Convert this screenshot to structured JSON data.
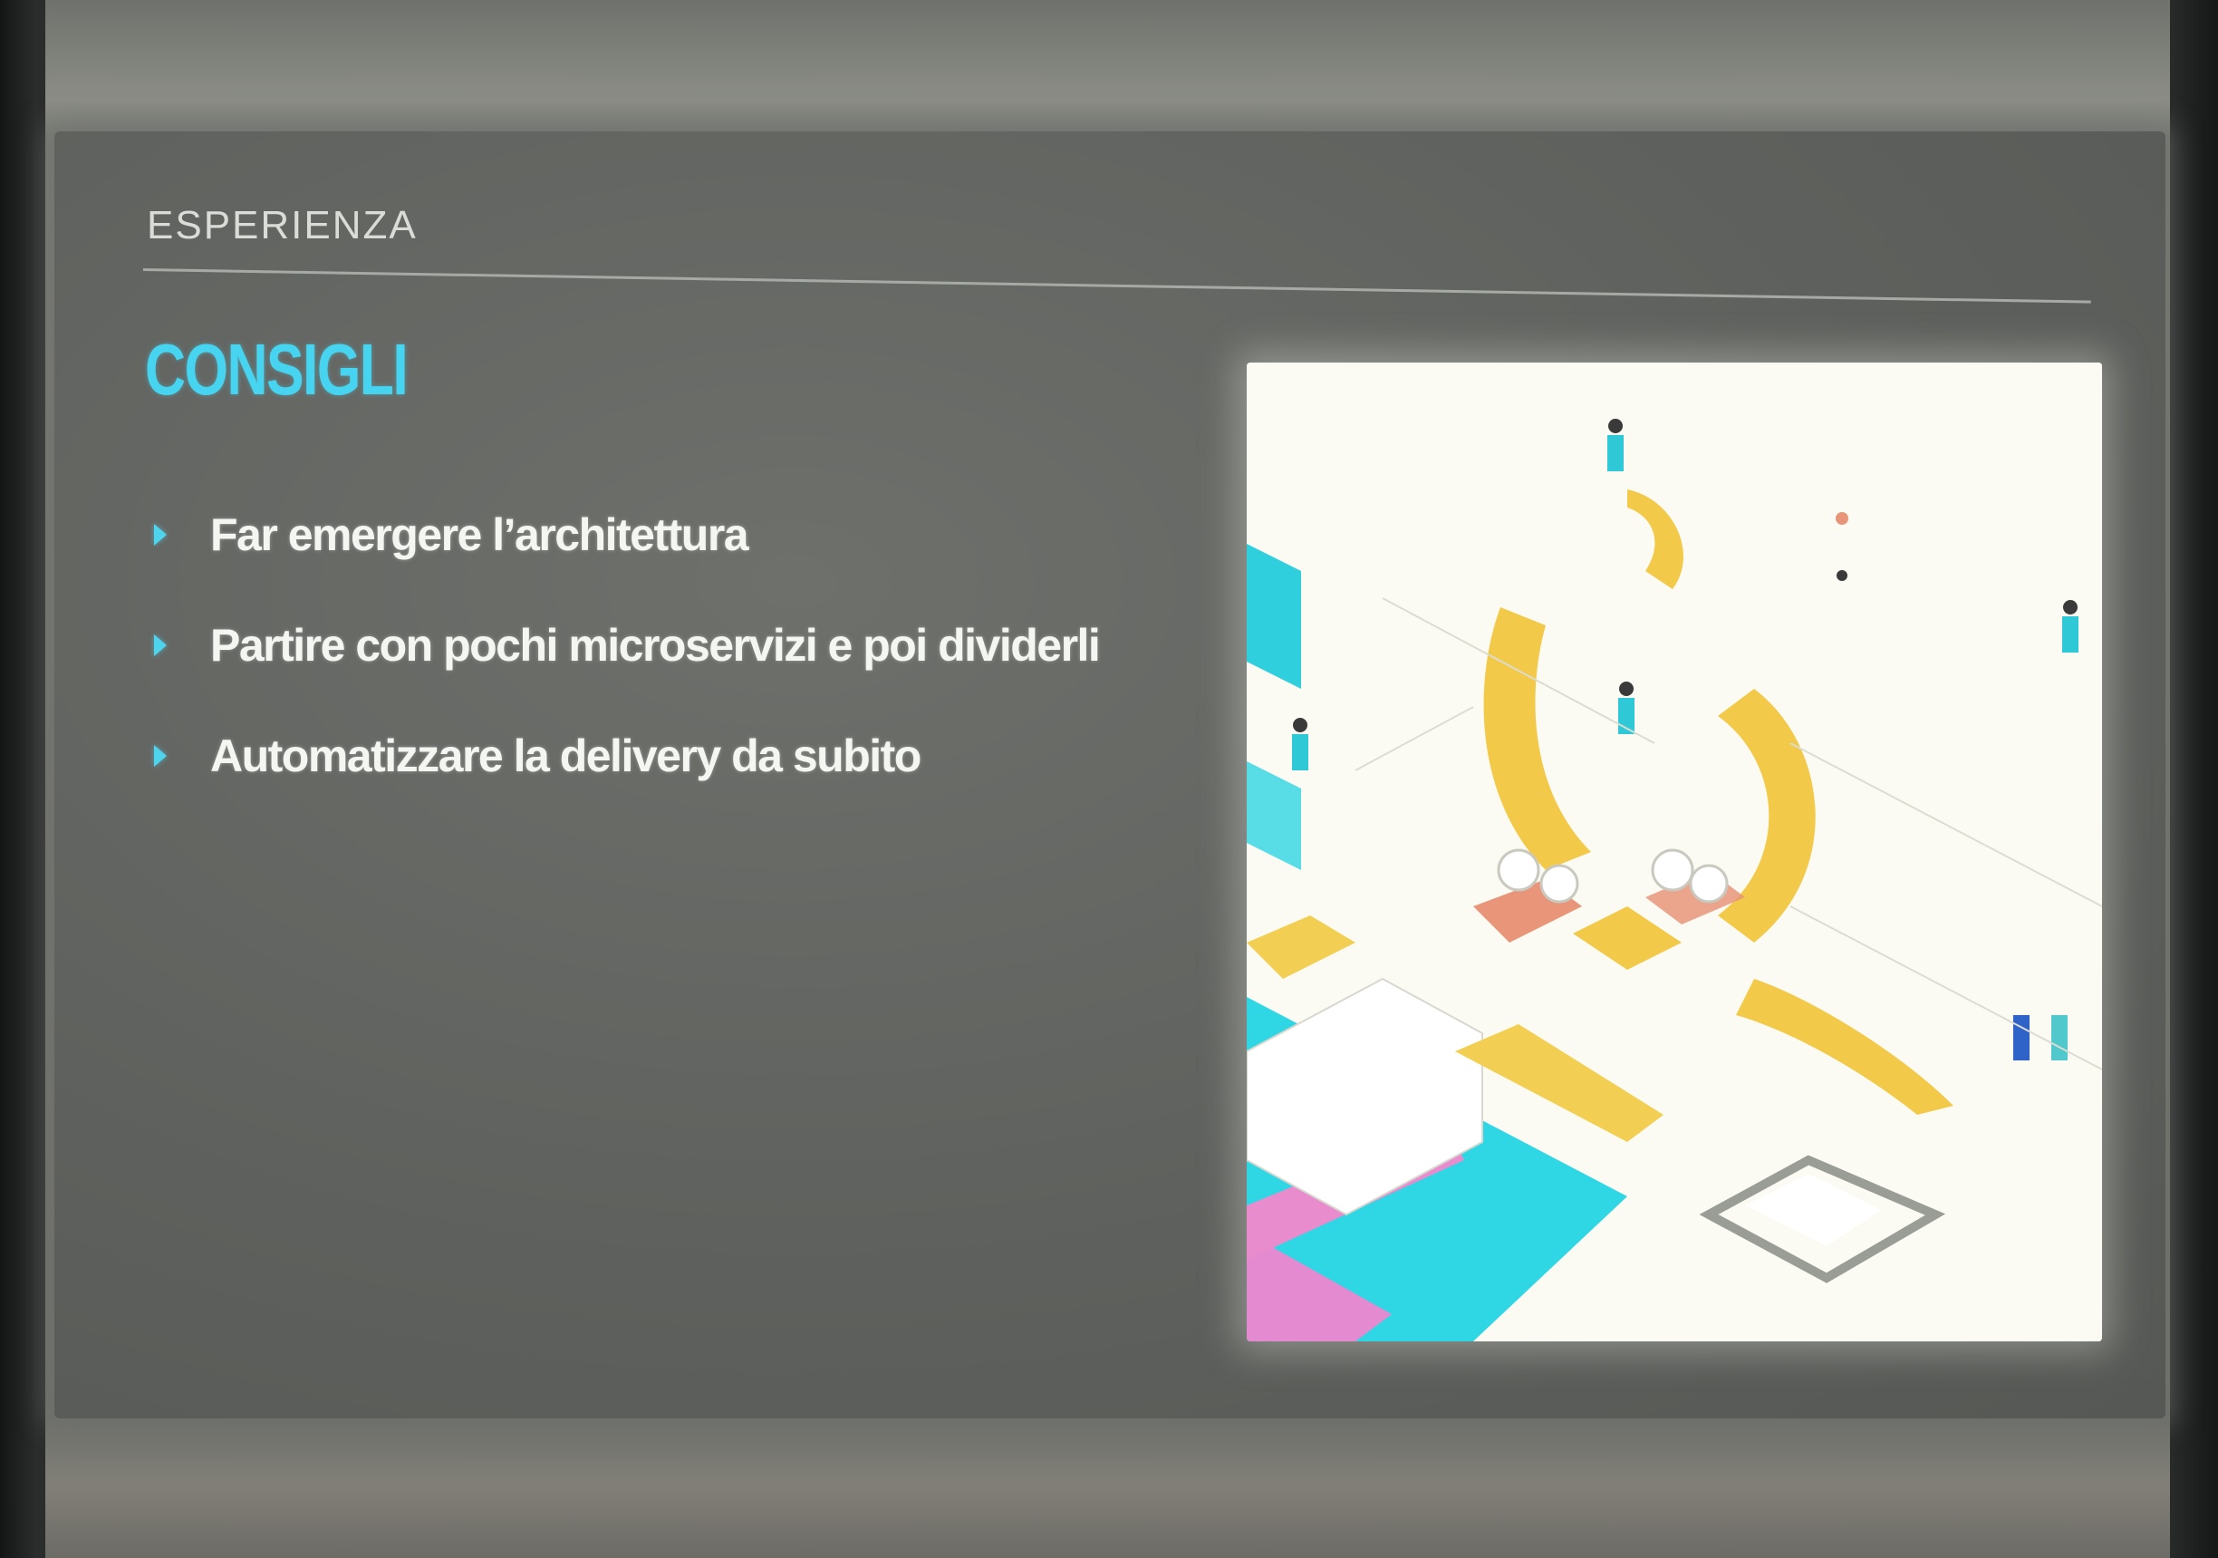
{
  "slide": {
    "section_label": "ESPERIENZA",
    "title": "CONSIGLI",
    "accent_color": "#47d4f0",
    "bullets": [
      "Far emergere l’architettura",
      "Partire con pochi microservizi e poi dividerli",
      "Automatizzare la delivery da subito"
    ],
    "illustration": {
      "icon": "isometric-office-illustration-icon",
      "colors": [
        "#f3c94a",
        "#28d9e6",
        "#e878c8",
        "#e89a78",
        "#ffffff"
      ]
    }
  }
}
